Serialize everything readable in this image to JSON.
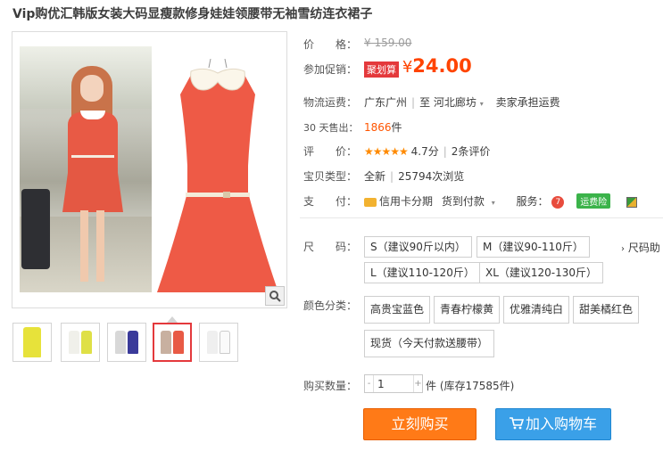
{
  "product": {
    "title": "Vip购优汇韩版女装大码显瘦款修身娃娃领腰带无袖雪纺连衣裙子"
  },
  "colors": {
    "price": "#ff4400",
    "promo_tag": "#e4393c",
    "buy_button": "#ff7a17",
    "cart_button": "#3aa0e8",
    "dress_red": "#ee5a46"
  },
  "price": {
    "label": "价　　格：",
    "original": "¥ 159.00"
  },
  "promo": {
    "label": "参加促销：",
    "tag": "聚划算",
    "currency": "¥",
    "amount": "24.00"
  },
  "shipping": {
    "label": "物流运费：",
    "from": "广东广州",
    "to_prefix": "至",
    "to": "河北廊坊",
    "fee": "卖家承担运费"
  },
  "sales": {
    "label": "30 天售出：",
    "count": "1866",
    "unit": "件"
  },
  "rating": {
    "label": "评　　价：",
    "stars": "★★★★★",
    "score": "4.7分",
    "reviews": "2条评价"
  },
  "type": {
    "label": "宝贝类型：",
    "condition": "全新",
    "views": "25794次浏览"
  },
  "payment": {
    "label": "支　　付：",
    "credit": "信用卡分期",
    "cod": "货到付款",
    "service_label": "服务：",
    "service_badge": "运费险"
  },
  "size": {
    "label": "尺　　码：",
    "options": [
      "S（建议90斤以内）",
      "M（建议90-110斤）",
      "L（建议110-120斤）",
      "XL（建议120-130斤）"
    ],
    "guide": "尺码助"
  },
  "color": {
    "label": "颜色分类：",
    "options": [
      "高贵宝蓝色",
      "青春柠檬黄",
      "优雅清纯白",
      "甜美橘红色",
      "现货（今天付款送腰带）"
    ]
  },
  "quantity": {
    "label": "购买数量：",
    "value": "1",
    "stock": "件 (库存17585件)"
  },
  "actions": {
    "buy_now": "立刻购买",
    "add_cart": "加入购物车"
  },
  "icons": {
    "zoom": "magnifier-icon",
    "cart": "cart-icon",
    "credit_card": "credit-card-icon",
    "dropdown": "chevron-down-icon",
    "seven_day": "seven-day-return-icon",
    "other_service": "service-icon"
  }
}
